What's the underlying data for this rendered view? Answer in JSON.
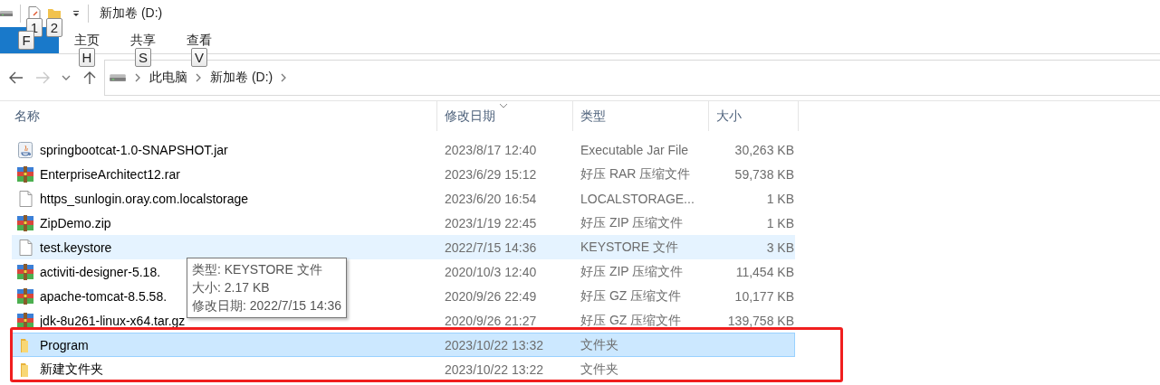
{
  "title_bar": {
    "title": "新加卷 (D:)",
    "quick_access_keytips": [
      "1",
      "2"
    ]
  },
  "ribbon_tabs": [
    {
      "kind": "file",
      "keytip": "F"
    },
    {
      "label": "主页",
      "kind": "tab",
      "keytip": "H"
    },
    {
      "label": "共享",
      "kind": "tab",
      "keytip": "S"
    },
    {
      "label": "查看",
      "kind": "tab",
      "keytip": "V"
    }
  ],
  "navigation": {
    "back": {
      "disabled": false
    },
    "forward": {
      "disabled": true
    }
  },
  "address_bar": {
    "crumbs": [
      "此电脑",
      "新加卷 (D:)"
    ]
  },
  "table": {
    "columns": [
      {
        "label": "名称",
        "sorted": false
      },
      {
        "label": "修改日期",
        "sorted": true
      },
      {
        "label": "类型",
        "sorted": false
      },
      {
        "label": "大小",
        "sorted": false
      }
    ],
    "rows": [
      {
        "kind": "jar",
        "name": "springbootcat-1.0-SNAPSHOT.jar",
        "date": "2023/8/17 12:40",
        "type": "Executable Jar File",
        "size": "30,263 KB",
        "hovered": false,
        "selected": false,
        "annotated": false
      },
      {
        "kind": "archive",
        "name": "EnterpriseArchitect12.rar",
        "date": "2023/6/29 15:12",
        "type": "好压 RAR 压缩文件",
        "size": "59,738 KB",
        "hovered": false,
        "selected": false,
        "annotated": false
      },
      {
        "kind": "file",
        "name": "https_sunlogin.oray.com.localstorage",
        "date": "2023/6/20 16:54",
        "type": "LOCALSTORAGE...",
        "size": "1 KB",
        "hovered": false,
        "selected": false,
        "annotated": false
      },
      {
        "kind": "archive",
        "name": "ZipDemo.zip",
        "date": "2023/1/19 22:45",
        "type": "好压 ZIP 压缩文件",
        "size": "1 KB",
        "hovered": false,
        "selected": false,
        "annotated": false
      },
      {
        "kind": "file",
        "name": "test.keystore",
        "date": "2022/7/15 14:36",
        "type": "KEYSTORE 文件",
        "size": "3 KB",
        "hovered": true,
        "selected": false,
        "annotated": false
      },
      {
        "kind": "archive",
        "name": "activiti-designer-5.18.",
        "date": "2020/10/3 12:40",
        "type": "好压 ZIP 压缩文件",
        "size": "11,454 KB",
        "hovered": false,
        "selected": false,
        "annotated": false
      },
      {
        "kind": "archive",
        "name": "apache-tomcat-8.5.58.",
        "date": "2020/9/26 22:49",
        "type": "好压 GZ 压缩文件",
        "size": "10,177 KB",
        "hovered": false,
        "selected": false,
        "annotated": false
      },
      {
        "kind": "archive",
        "name": "jdk-8u261-linux-x64.tar.gz",
        "date": "2020/9/26 21:27",
        "type": "好压 GZ 压缩文件",
        "size": "139,758 KB",
        "hovered": false,
        "selected": false,
        "annotated": false
      },
      {
        "kind": "folder",
        "name": "Program",
        "date": "2023/10/22 13:32",
        "type": "文件夹",
        "hovered": false,
        "selected": true,
        "annotated": true
      },
      {
        "kind": "folder",
        "name": "新建文件夹",
        "date": "2023/10/22 13:22",
        "type": "文件夹",
        "hovered": false,
        "selected": false,
        "annotated": true
      }
    ]
  },
  "tooltip": {
    "lines": [
      "类型: KEYSTORE 文件",
      "大小: 2.17 KB",
      "修改日期: 2022/7/15 14:36"
    ]
  }
}
